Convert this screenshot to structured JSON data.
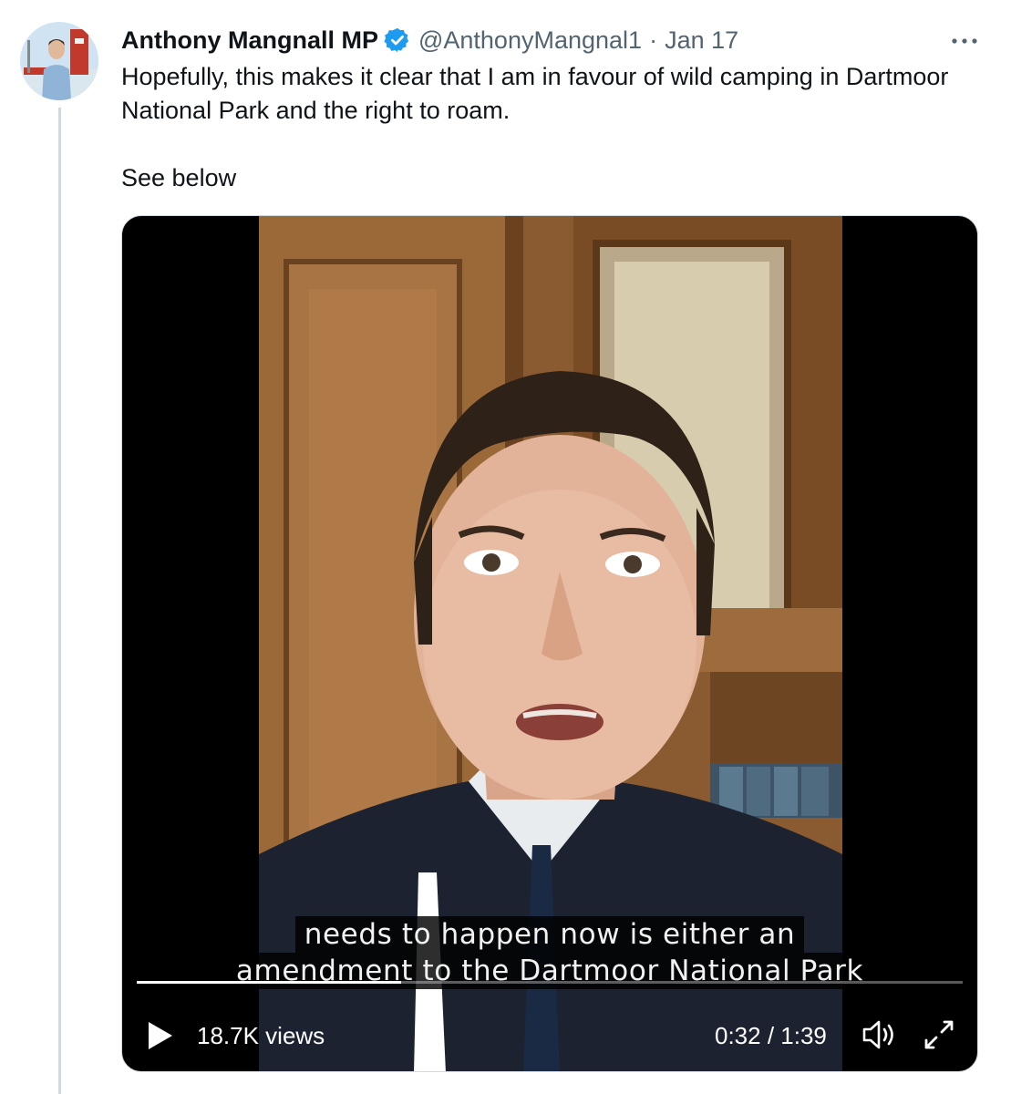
{
  "tweet": {
    "author_name": "Anthony Mangnall MP",
    "handle": "@AnthonyMangnal1",
    "separator": "·",
    "date": "Jan 17",
    "more_label": "•••",
    "paragraphs": [
      "Hopefully, this makes it clear that I am in favour of wild camping in Dartmoor National Park and the right to roam.",
      "See below"
    ]
  },
  "video": {
    "caption_line1": "needs to happen now is either an",
    "caption_line2": "amendment to the Dartmoor National Park",
    "views": "18.7K views",
    "time": "0:32 / 1:39",
    "progress_fraction": 0.32,
    "icons": [
      "play-icon",
      "volume-icon",
      "fullscreen-icon"
    ]
  },
  "colors": {
    "verified": "#1d9bf0",
    "text": "#0f1419",
    "secondary": "#536471",
    "thread_line": "#cfd9de"
  }
}
